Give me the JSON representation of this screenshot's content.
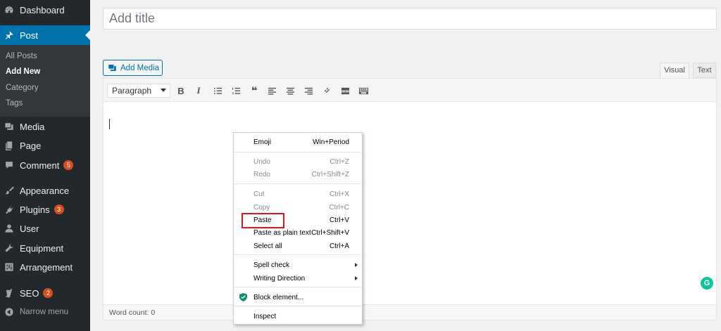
{
  "sidebar": {
    "dashboard": "Dashboard",
    "post": "Post",
    "sub": [
      "All Posts",
      "Add New",
      "Category",
      "Tags"
    ],
    "media": "Media",
    "page": "Page",
    "comment": "Comment",
    "comment_badge": "5",
    "appearance": "Appearance",
    "plugins": "Plugins",
    "plugins_badge": "3",
    "user": "User",
    "equipment": "Equipment",
    "arrangement": "Arrangement",
    "seo": "SEO",
    "seo_badge": "2",
    "collapse": "Narrow menu"
  },
  "editor": {
    "title_placeholder": "Add title",
    "add_media": "Add Media",
    "tab_visual": "Visual",
    "tab_text": "Text",
    "format": "Paragraph",
    "word_count": "Word count: 0",
    "bold": "B",
    "italic": "I",
    "quote": "❝",
    "grammarly": "G"
  },
  "context_menu": {
    "emoji": {
      "label": "Emoji",
      "shortcut": "Win+Period"
    },
    "undo": {
      "label": "Undo",
      "shortcut": "Ctrl+Z"
    },
    "redo": {
      "label": "Redo",
      "shortcut": "Ctrl+Shift+Z"
    },
    "cut": {
      "label": "Cut",
      "shortcut": "Ctrl+X"
    },
    "copy": {
      "label": "Copy",
      "shortcut": "Ctrl+C"
    },
    "paste": {
      "label": "Paste",
      "shortcut": "Ctrl+V"
    },
    "paste_plain": {
      "label": "Paste as plain text",
      "shortcut": "Ctrl+Shift+V"
    },
    "select_all": {
      "label": "Select all",
      "shortcut": "Ctrl+A"
    },
    "spell_check": {
      "label": "Spell check"
    },
    "writing_direction": {
      "label": "Writing Direction"
    },
    "block_element": {
      "label": "Block element..."
    },
    "inspect": {
      "label": "Inspect"
    }
  },
  "colors": {
    "sidebar_bg": "#23282d",
    "accent": "#0073aa",
    "badge": "#d54e21",
    "highlight": "#e0161d"
  }
}
